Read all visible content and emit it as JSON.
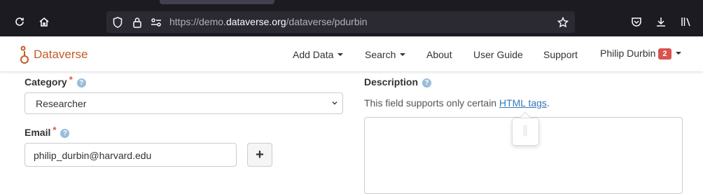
{
  "browser": {
    "url_prefix": "https://demo.",
    "url_domain": "dataverse.org",
    "url_path": "/dataverse/pdurbin"
  },
  "navbar": {
    "brand": "Dataverse",
    "add_data": "Add Data",
    "search": "Search",
    "about": "About",
    "user_guide": "User Guide",
    "support": "Support",
    "user_name": "Philip Durbin",
    "notification_count": "2"
  },
  "form": {
    "category_label": "Category",
    "category_value": "Researcher",
    "email_label": "Email",
    "email_value": "philip_durbin@harvard.edu",
    "add_button": "+",
    "required_mark": "*",
    "help_mark": "?",
    "description_label": "Description",
    "description_help_prefix": "This field supports only certain ",
    "description_help_link": "HTML tags",
    "description_help_suffix": "."
  },
  "colors": {
    "brand": "#c55b28",
    "link": "#337ab7",
    "badge": "#d9534f",
    "browser_bg": "#1c1b22"
  }
}
